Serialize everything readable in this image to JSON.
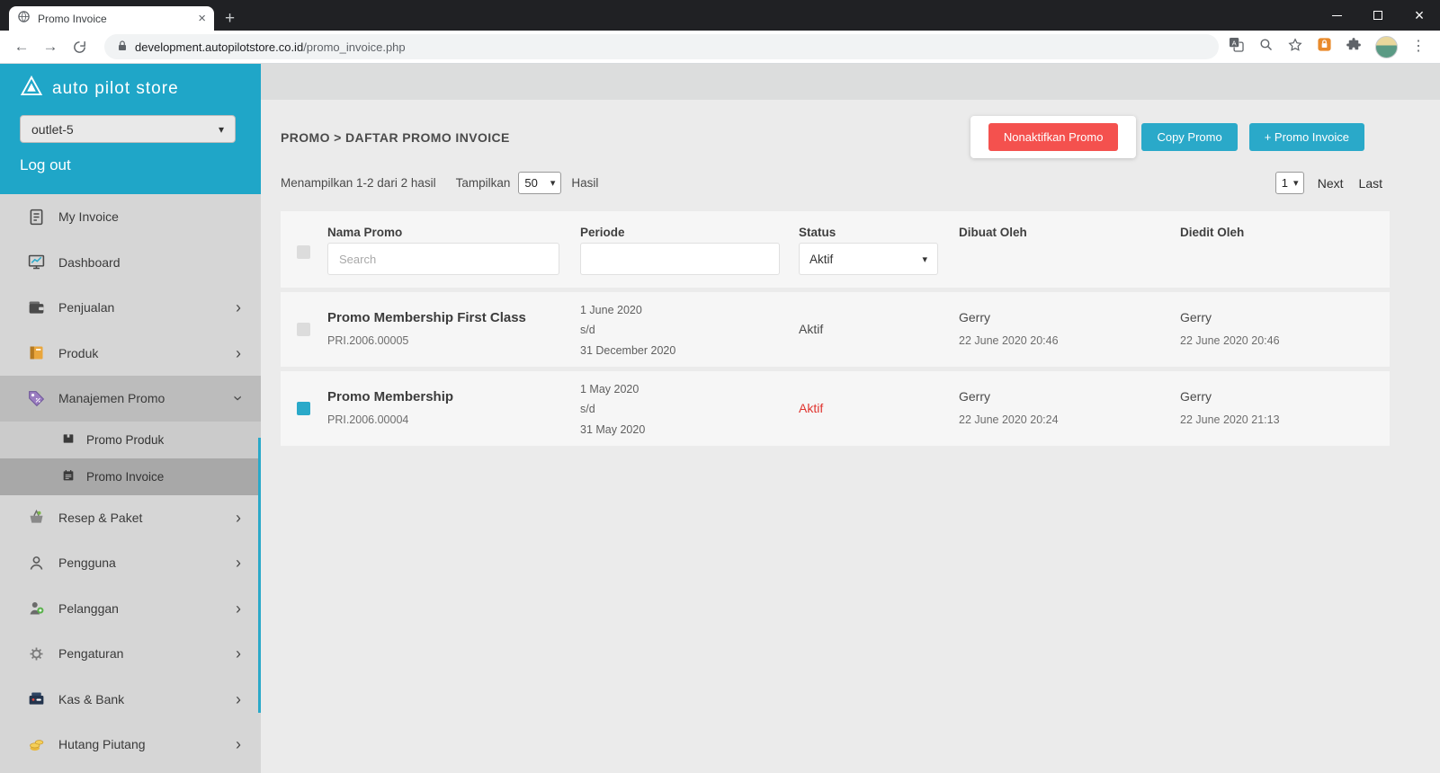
{
  "colors": {
    "brand_teal": "#2aa9c9",
    "sidebar_teal": "#1fa6c8",
    "danger_red": "#f4514e",
    "status_active_red": "#e0342e"
  },
  "browser": {
    "tab_title": "Promo Invoice",
    "url_domain": "development.autopilotstore.co.id",
    "url_path": "/promo_invoice.php"
  },
  "sidebar": {
    "logo_text": "auto pilot store",
    "outlet_selected": "outlet-5",
    "logout_label": "Log out",
    "items": [
      {
        "label": "My Invoice"
      },
      {
        "label": "Dashboard"
      },
      {
        "label": "Penjualan"
      },
      {
        "label": "Produk"
      },
      {
        "label": "Manajemen Promo",
        "expanded": true,
        "children": [
          {
            "label": "Promo Produk"
          },
          {
            "label": "Promo Invoice",
            "active": true
          }
        ]
      },
      {
        "label": "Resep & Paket"
      },
      {
        "label": "Pengguna"
      },
      {
        "label": "Pelanggan"
      },
      {
        "label": "Pengaturan"
      },
      {
        "label": "Kas & Bank"
      },
      {
        "label": "Hutang Piutang"
      }
    ]
  },
  "main": {
    "breadcrumb": "PROMO > DAFTAR PROMO INVOICE",
    "buttons": {
      "deactivate": "Nonaktifkan Promo",
      "copy": "Copy Promo",
      "add": "+ Promo Invoice"
    },
    "results_text": "Menampilkan 1-2 dari 2 hasil",
    "show_label": "Tampilkan",
    "page_size": "50",
    "results_label": "Hasil",
    "pagination": {
      "page": "1",
      "next_label": "Next",
      "last_label": "Last"
    },
    "table": {
      "headers": [
        "Nama Promo",
        "Periode",
        "Status",
        "Dibuat Oleh",
        "Diedit Oleh"
      ],
      "search_placeholder": "Search",
      "status_filter_value": "Aktif",
      "rows": [
        {
          "checked": false,
          "name": "Promo Membership First Class",
          "code": "PRI.2006.00005",
          "period": [
            "1 June 2020",
            "s/d",
            "31 December 2020"
          ],
          "status": "Aktif",
          "status_highlight": false,
          "created_by": "Gerry",
          "created_at": "22 June 2020 20:46",
          "edited_by": "Gerry",
          "edited_at": "22 June 2020 20:46"
        },
        {
          "checked": true,
          "name": "Promo Membership",
          "code": "PRI.2006.00004",
          "period": [
            "1 May 2020",
            "s/d",
            "31 May 2020"
          ],
          "status": "Aktif",
          "status_highlight": true,
          "created_by": "Gerry",
          "created_at": "22 June 2020 20:24",
          "edited_by": "Gerry",
          "edited_at": "22 June 2020 21:13"
        }
      ]
    }
  }
}
